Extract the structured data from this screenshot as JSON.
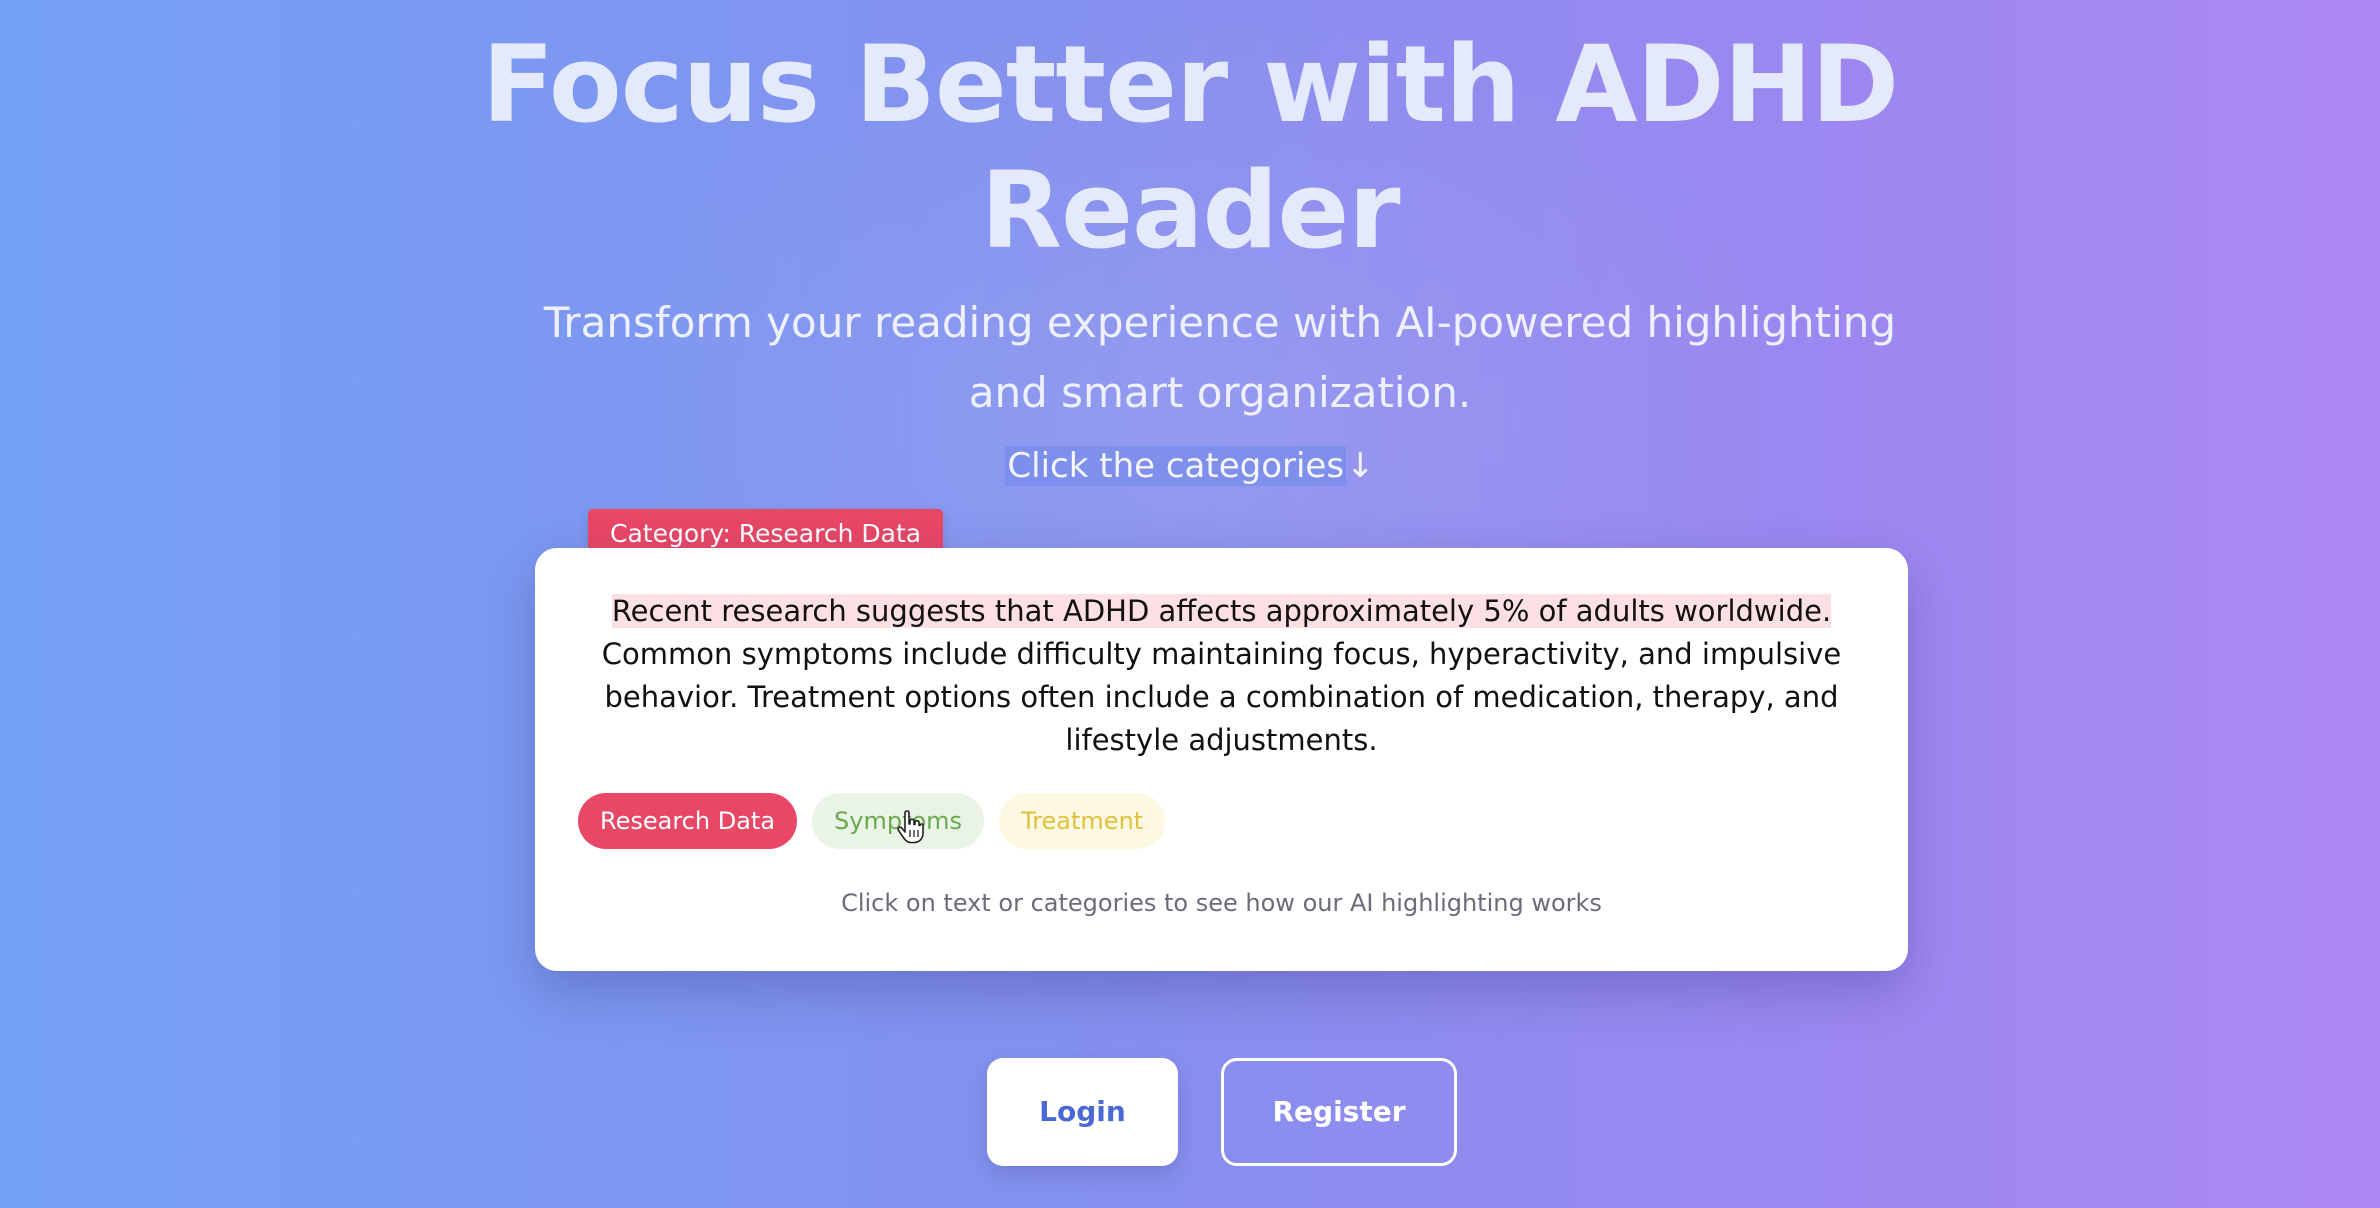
{
  "hero": {
    "title": "Focus Better with ADHD Reader",
    "subtitle": "Transform your reading experience with AI-powered highlighting and smart organization.",
    "hint": "Click the categories",
    "hint_arrow": "↓"
  },
  "demo": {
    "category_tag": "Category: Research Data",
    "highlighted_sentence": "Recent research suggests that ADHD affects approximately 5% of adults worldwide.",
    "rest_text": " Common symptoms include difficulty maintaining focus, hyperactivity, and impulsive behavior. Treatment options often include a combination of medication, therapy, and lifestyle adjustments.",
    "chips": [
      {
        "label": "Research Data",
        "color": "#e84766",
        "active": true
      },
      {
        "label": "Symptoms",
        "color": "#6aaa4e",
        "active": false
      },
      {
        "label": "Treatment",
        "color": "#e0c13b",
        "active": false
      }
    ],
    "footer": "Click on text or categories to see how our AI highlighting works"
  },
  "actions": {
    "login_label": "Login",
    "register_label": "Register"
  },
  "colors": {
    "accent_research": "#e84766",
    "highlight_bg": "#fde0e4",
    "login_text": "#4a68d6"
  },
  "icons": {
    "cursor": "hand-pointer-icon"
  }
}
